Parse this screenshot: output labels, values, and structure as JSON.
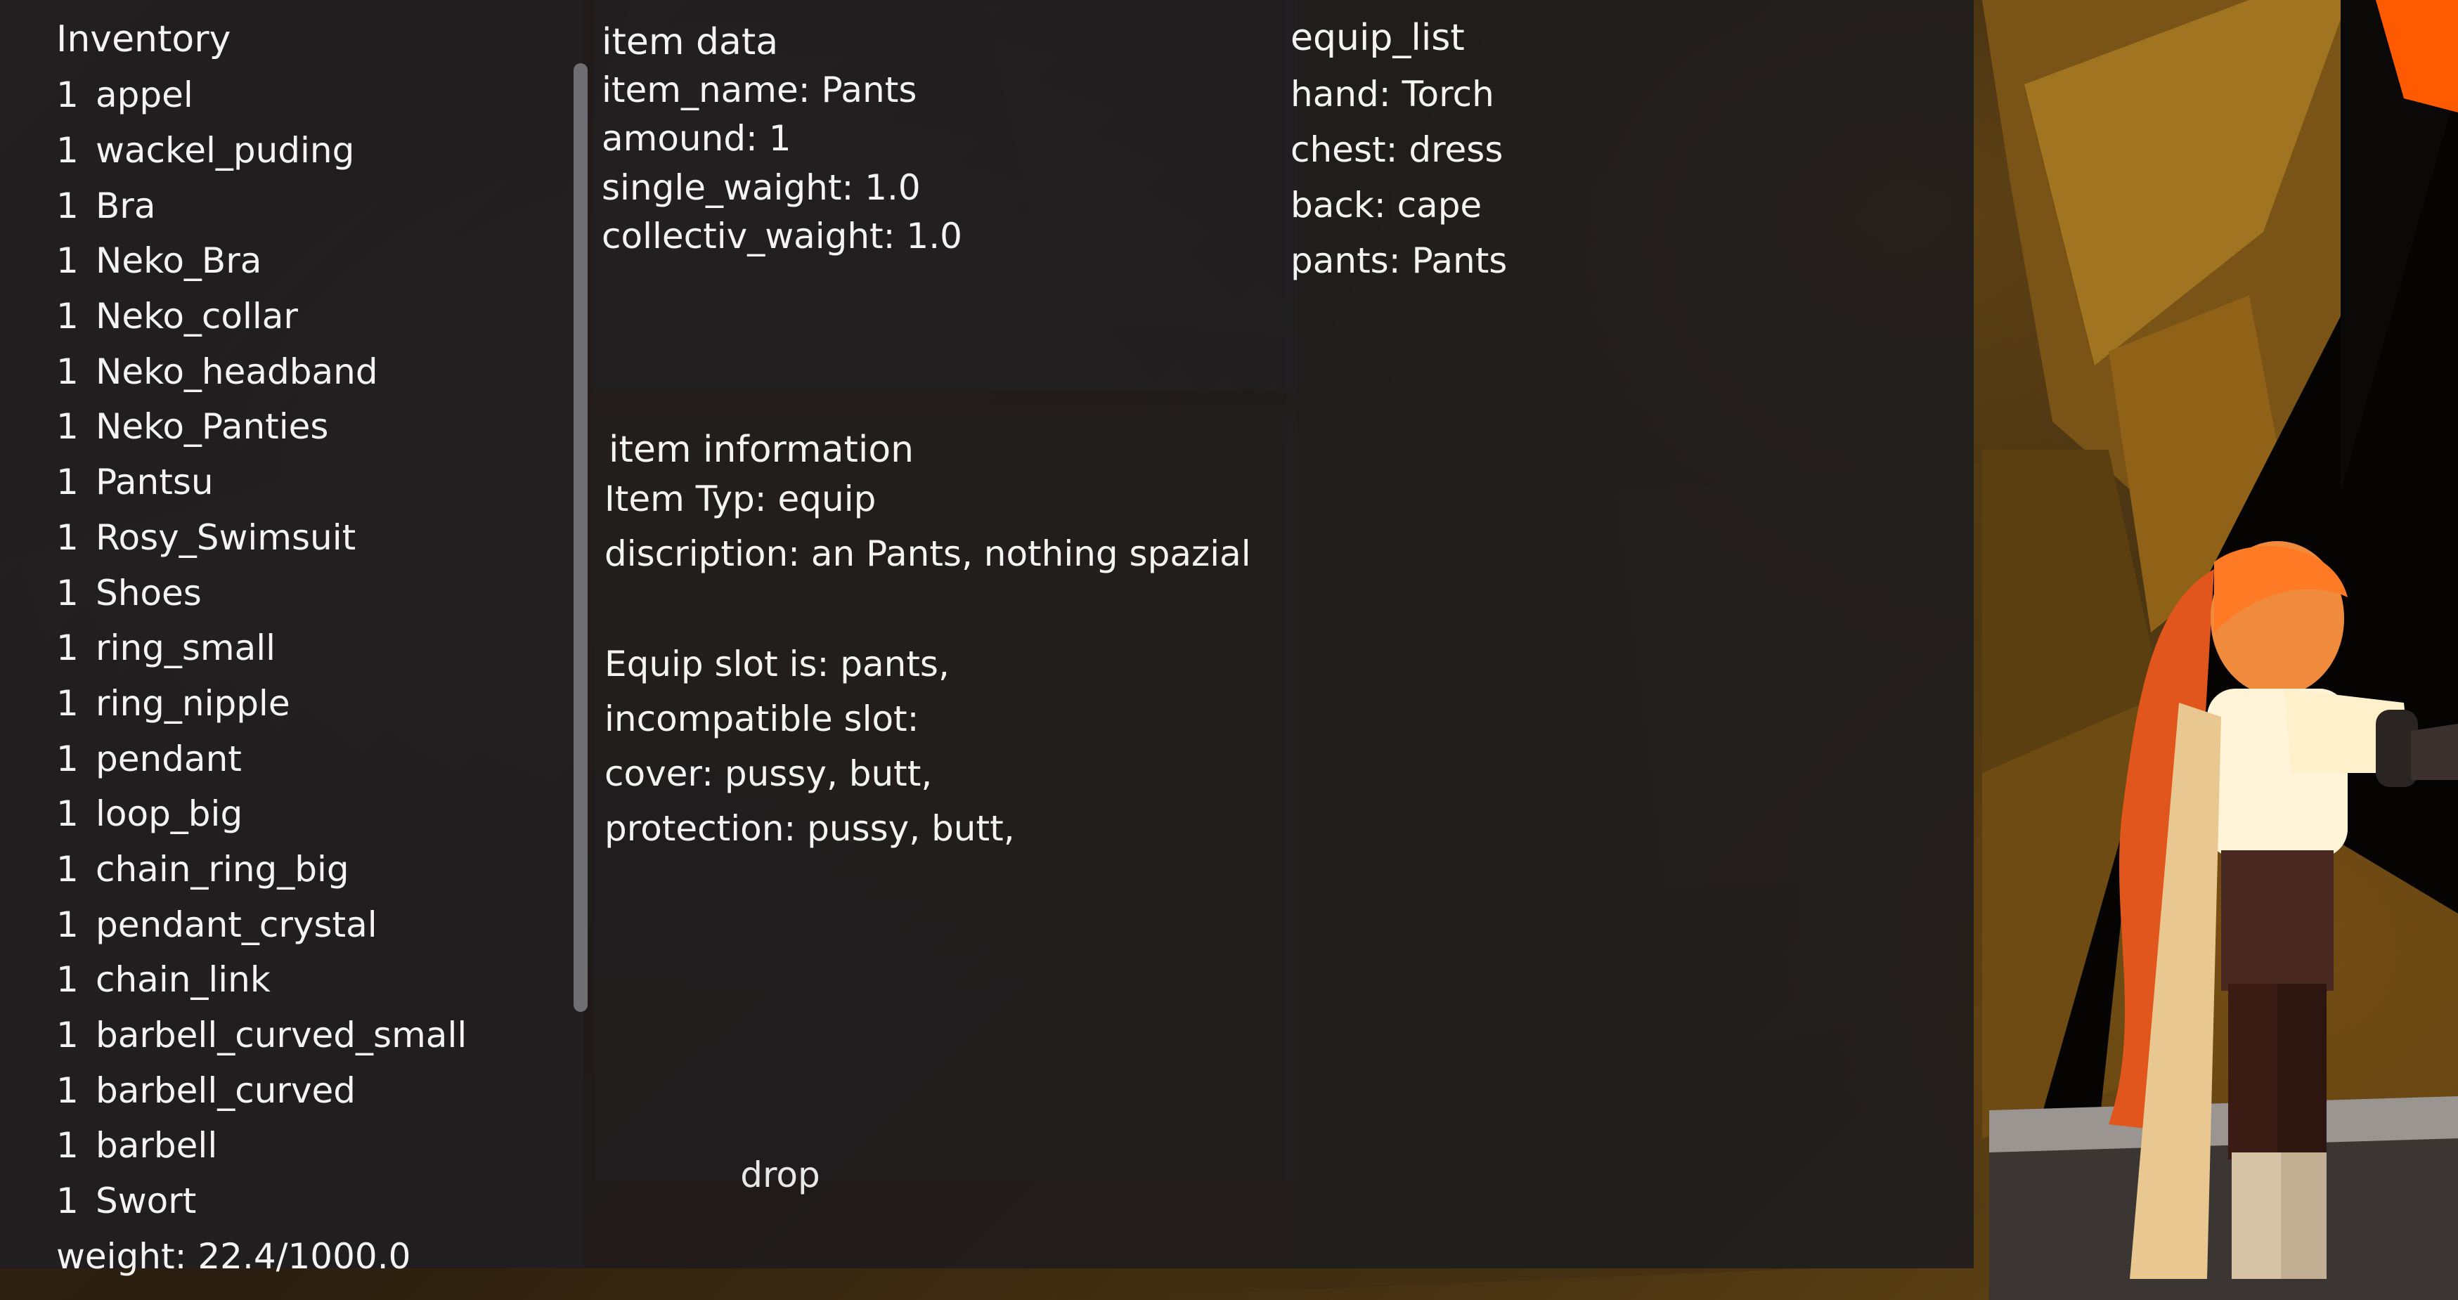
{
  "inventory": {
    "title": "Inventory",
    "items": [
      {
        "qty": "1",
        "name": "appel"
      },
      {
        "qty": "1",
        "name": "wackel_puding"
      },
      {
        "qty": "1",
        "name": "Bra"
      },
      {
        "qty": "1",
        "name": "Neko_Bra"
      },
      {
        "qty": "1",
        "name": "Neko_collar"
      },
      {
        "qty": "1",
        "name": "Neko_headband"
      },
      {
        "qty": "1",
        "name": "Neko_Panties"
      },
      {
        "qty": "1",
        "name": "Pantsu"
      },
      {
        "qty": "1",
        "name": "Rosy_Swimsuit"
      },
      {
        "qty": "1",
        "name": "Shoes"
      },
      {
        "qty": "1",
        "name": "ring_small"
      },
      {
        "qty": "1",
        "name": "ring_nipple"
      },
      {
        "qty": "1",
        "name": "pendant"
      },
      {
        "qty": "1",
        "name": "loop_big"
      },
      {
        "qty": "1",
        "name": "chain_ring_big"
      },
      {
        "qty": "1",
        "name": "pendant_crystal"
      },
      {
        "qty": "1",
        "name": "chain_link"
      },
      {
        "qty": "1",
        "name": "barbell_curved_small"
      },
      {
        "qty": "1",
        "name": "barbell_curved"
      },
      {
        "qty": "1",
        "name": "barbell"
      },
      {
        "qty": "1",
        "name": "Swort"
      }
    ],
    "weight": "weight: 22.4/1000.0"
  },
  "item_data": {
    "title": "item data",
    "item_name": "item_name: Pants",
    "amount": "amound: 1",
    "single_weight": "single_waight: 1.0",
    "collective_weight": "collectiv_waight: 1.0"
  },
  "item_information": {
    "title": "item information",
    "type": "Item Typ: equip",
    "description": "discription: an Pants, nothing spazial",
    "equip_slot": "Equip slot is: pants,",
    "incompatible": "incompatible slot:",
    "cover": "cover: pussy,  butt,",
    "protection": "protection: pussy,  butt,"
  },
  "equip_list": {
    "title": "equip_list",
    "hand": "hand: Torch",
    "chest": "chest: dress",
    "back": "back: cape",
    "pants": "pants: Pants"
  },
  "actions": {
    "drop_label": "drop"
  }
}
